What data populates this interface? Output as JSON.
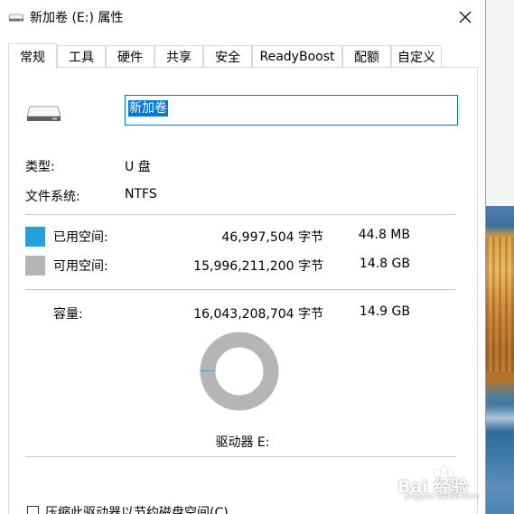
{
  "window": {
    "title": "新加卷 (E:) 属性"
  },
  "tabs": [
    {
      "label": "常规",
      "active": true
    },
    {
      "label": "工具",
      "active": false
    },
    {
      "label": "硬件",
      "active": false
    },
    {
      "label": "共享",
      "active": false
    },
    {
      "label": "安全",
      "active": false
    },
    {
      "label": "ReadyBoost",
      "active": false
    },
    {
      "label": "配额",
      "active": false
    },
    {
      "label": "自定义",
      "active": false
    }
  ],
  "general": {
    "volume_name": "新加卷",
    "type_label": "类型:",
    "type_value": "U 盘",
    "fs_label": "文件系统:",
    "fs_value": "NTFS",
    "used": {
      "label": "已用空间:",
      "bytes": "46,997,504 字节",
      "size": "44.8 MB",
      "color": "#26a0da"
    },
    "free": {
      "label": "可用空间:",
      "bytes": "15,996,211,200 字节",
      "size": "14.8 GB",
      "color": "#b5b5b5"
    },
    "capacity": {
      "label": "容量:",
      "bytes": "16,043,208,704 字节",
      "size": "14.9 GB"
    },
    "used_fraction": 0.0029,
    "drive_label": "驱动器 E:",
    "compress_label": "压缩此驱动器以节约磁盘空间(C)"
  },
  "watermark": {
    "text": "Bai 经验",
    "url": "jingyan.baidu.com"
  }
}
